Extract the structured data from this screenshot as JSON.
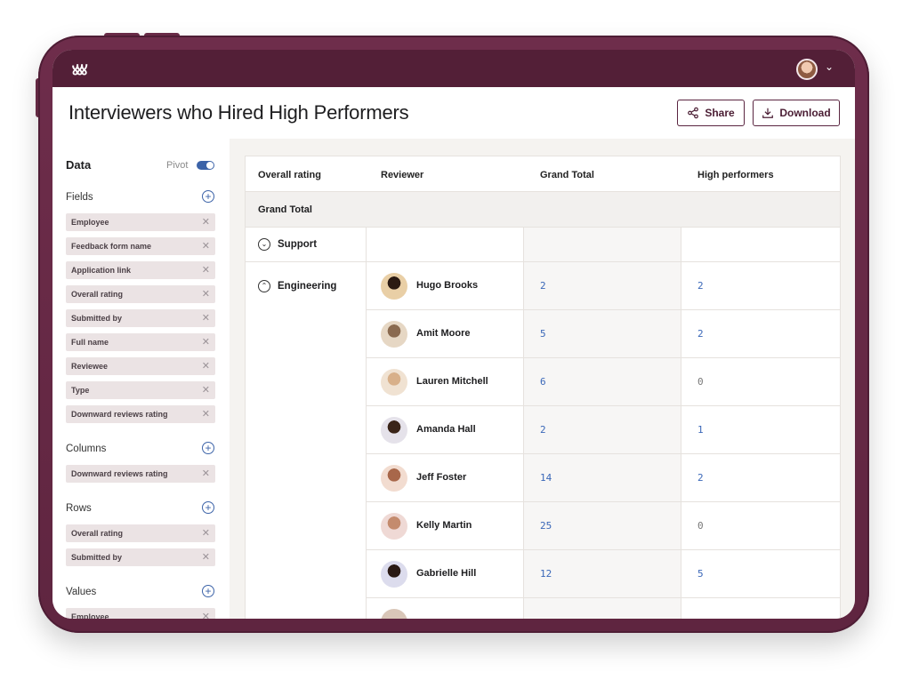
{
  "header": {
    "title": "Interviewers who Hired High Performers",
    "share_label": "Share",
    "download_label": "Download"
  },
  "sidebar": {
    "title": "Data",
    "pivot_label": "Pivot",
    "pivot_on": true,
    "sections": {
      "fields": "Fields",
      "columns": "Columns",
      "rows": "Rows",
      "values": "Values"
    },
    "field_chips": [
      "Employee",
      "Feedback form name",
      "Application link",
      "Overall rating",
      "Submitted by",
      "Full name",
      "Reviewee",
      "Type",
      "Downward reviews rating"
    ],
    "column_chips": [
      "Downward reviews rating"
    ],
    "row_chips": [
      "Overall rating",
      "Submitted by"
    ],
    "value_chips": [
      "Employee"
    ]
  },
  "table": {
    "headers": [
      "Overall rating",
      "Reviewer",
      "Grand Total",
      "High performers"
    ],
    "grand_total_label": "Grand Total",
    "groups": [
      "Support",
      "Engineering"
    ],
    "rows": [
      {
        "name": "Hugo Brooks",
        "grand_total": "2",
        "high_performers": "2"
      },
      {
        "name": "Amit Moore",
        "grand_total": "5",
        "high_performers": "2"
      },
      {
        "name": "Lauren Mitchell",
        "grand_total": "6",
        "high_performers": "0"
      },
      {
        "name": "Amanda Hall",
        "grand_total": "2",
        "high_performers": "1"
      },
      {
        "name": "Jeff Foster",
        "grand_total": "14",
        "high_performers": "2"
      },
      {
        "name": "Kelly Martin",
        "grand_total": "25",
        "high_performers": "0"
      },
      {
        "name": "Gabrielle Hill",
        "grand_total": "12",
        "high_performers": "5"
      }
    ]
  },
  "colors": {
    "frame": "#6e2d4b",
    "topbar": "#531f37",
    "accent": "#3a67b8",
    "chip_bg": "#ebe3e4"
  },
  "icons": {
    "logo": "brand-logo",
    "share": "share-icon",
    "download": "download-icon",
    "remove": "close-icon",
    "add": "plus-circle-icon",
    "expand": "chevron-down-circle-icon",
    "collapse": "chevron-up-circle-icon"
  }
}
